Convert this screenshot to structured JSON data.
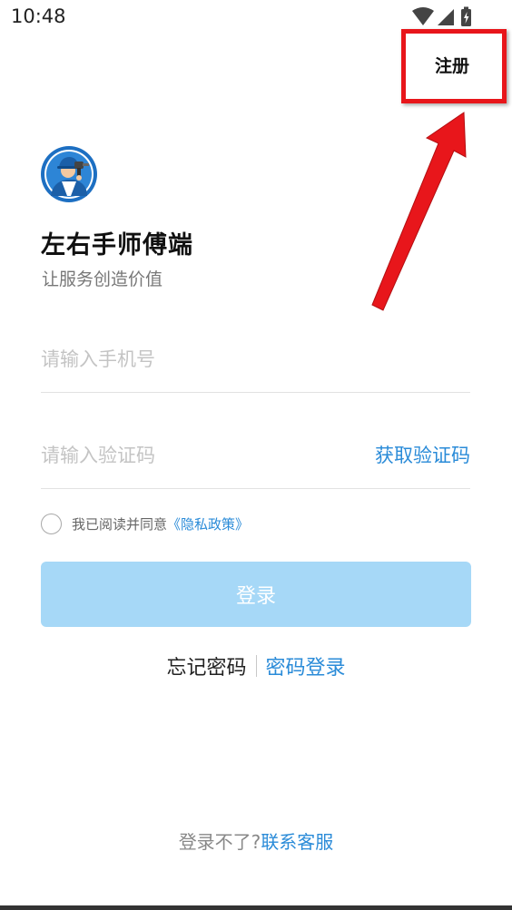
{
  "status_bar": {
    "time": "10:48"
  },
  "header": {
    "register_label": "注册"
  },
  "app": {
    "title": "左右手师傅端",
    "subtitle": "让服务创造价值"
  },
  "form": {
    "phone_placeholder": "请输入手机号",
    "phone_value": "",
    "code_placeholder": "请输入验证码",
    "code_value": "",
    "get_code_label": "获取验证码",
    "agree_text": "我已阅读并同意",
    "policy_link": "《隐私政策》",
    "login_label": "登录"
  },
  "links": {
    "forgot_password": "忘记密码",
    "password_login": "密码登录"
  },
  "footer": {
    "cannot_login": "登录不了?",
    "contact_support": "联系客服"
  },
  "colors": {
    "accent": "#2a8bd8",
    "login_button": "#a6d8f7",
    "highlight": "#e8161b"
  },
  "icons": {
    "wifi": "wifi-icon",
    "signal": "signal-icon",
    "battery": "battery-charging-icon",
    "logo": "worker-with-drill-logo",
    "arrow": "red-arrow-annotation"
  }
}
